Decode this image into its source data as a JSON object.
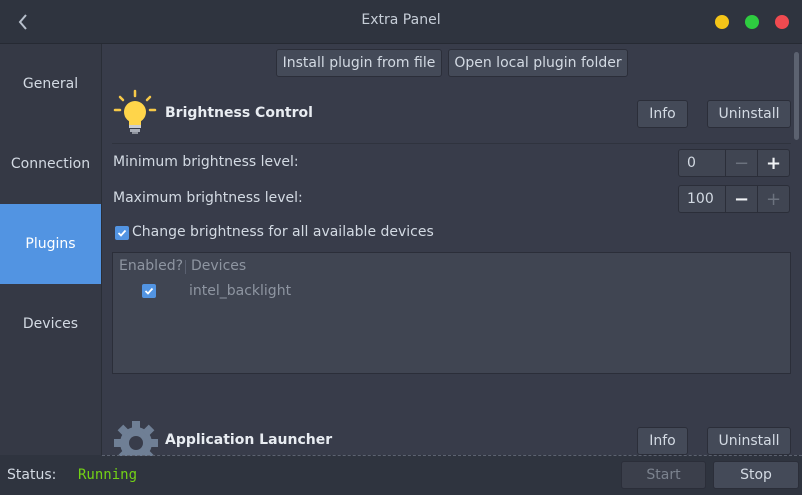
{
  "window": {
    "title": "Extra Panel",
    "back_icon": "chevron-left-icon",
    "controls": {
      "minimize_color": "#f5c518",
      "maximize_color": "#2ecc40",
      "close_color": "#f04a50"
    }
  },
  "sidebar": {
    "items": [
      {
        "label": "General",
        "active": false
      },
      {
        "label": "Connection",
        "active": false
      },
      {
        "label": "Plugins",
        "active": true
      },
      {
        "label": "Devices",
        "active": false
      }
    ],
    "accent_color": "#5294e2"
  },
  "toolbar": {
    "install_label": "Install plugin from file",
    "open_folder_label": "Open local plugin folder"
  },
  "plugins": [
    {
      "name": "Brightness Control",
      "icon": "lightbulb-icon",
      "info_label": "Info",
      "uninstall_label": "Uninstall",
      "min_label": "Minimum brightness level:",
      "min_value": "0",
      "max_label": "Maximum brightness level:",
      "max_value": "100",
      "all_devices_label": "Change brightness for all available devices",
      "all_devices_checked": true,
      "table": {
        "headers": [
          "Enabled?",
          "Devices"
        ],
        "rows": [
          {
            "enabled": true,
            "device": "intel_backlight"
          }
        ]
      }
    },
    {
      "name": "Application Launcher",
      "icon": "gear-icon",
      "info_label": "Info",
      "uninstall_label": "Uninstall"
    }
  ],
  "status": {
    "label": "Status:",
    "value": "Running",
    "value_color": "#73d216",
    "start_label": "Start",
    "stop_label": "Stop"
  }
}
